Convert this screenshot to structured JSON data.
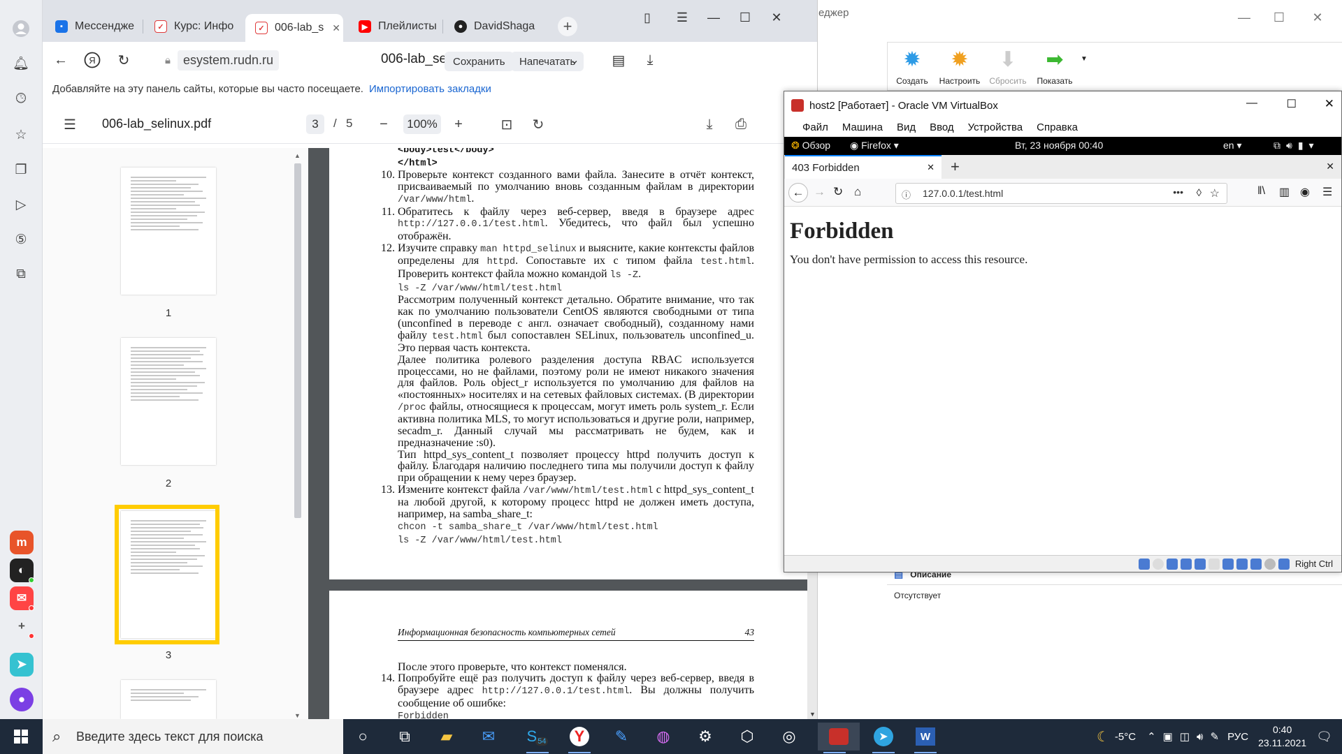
{
  "browser": {
    "tabs": [
      {
        "label": "Мессендже",
        "fav_color": "#1a73e8"
      },
      {
        "label": "Курс: Инфо",
        "fav_color": "#e03a3a"
      },
      {
        "label": "006-lab_s",
        "fav_color": "#e03a3a"
      },
      {
        "label": "Плейлисты",
        "fav_color": "#ff0000"
      },
      {
        "label": "DavidShaga",
        "fav_color": "#222222"
      }
    ],
    "url": "esystem.rudn.ru",
    "doc_title": "006-lab_selinux.pdf",
    "save_label": "Сохранить",
    "print_label": "Напечатать",
    "bookmarks_hint": "Добавляйте на эту панель сайты, которые вы часто посещаете.",
    "import_link": "Импортировать закладки"
  },
  "pdf": {
    "file_name": "006-lab_selinux.pdf",
    "current_page": "3",
    "page_sep": "/",
    "total_pages": "5",
    "zoom": "100%",
    "thumbnails": [
      "1",
      "2",
      "3"
    ],
    "page3": {
      "top_code": "<body>test</body>",
      "top_code2": "</html>",
      "items": [
        {
          "num": "10.",
          "html": "Проверьте контекст созданного вами файла. Занесите в отчёт контекст, присваиваемый по умолчанию вновь созданным файлам в директории <span class='mono'>/var/www/html</span>."
        },
        {
          "num": "11.",
          "html": "Обратитесь к файлу через веб-сервер, введя в браузере адрес <span class='mono'>http://127.0.0.1/test.html</span>. Убедитесь, что файл был успешно отображён."
        },
        {
          "num": "12.",
          "html": "Изучите справку <span class='mono'>man httpd_selinux</span> и выясните, какие контексты файлов определены для <span class='mono'>httpd</span>. Сопоставьте их с типом файла <span class='mono'>test.html</span>. Проверить контекст файла можно командой <span class='mono'>ls -Z</span>.<br><span class='mono'>ls -Z /var/www/html/test.html</span><br>Рассмотрим полученный контекст детально. Обратите внимание, что так как по умолчанию пользователи CentOS являются свободными от типа (unconfined в переводе с англ. означает свободный), созданному нами файлу <span class='mono'>test.html</span> был сопоставлен SELinux, пользователь unconfined_u. Это первая часть контекста.<br>Далее политика ролевого разделения доступа RBAC используется процессами, но не файлами, поэтому роли не имеют никакого значения для файлов. Роль object_r используется по умолчанию для файлов на «постоянных» носителях и на сетевых файловых системах. (В директории <span class='mono'>/proc</span> файлы, относящиеся к процессам, могут иметь роль system_r. Если активна политика MLS, то могут использоваться и другие роли, например, secadm_r. Данный случай мы рассматривать не будем, как и предназначение :s0).<br>Тип httpd_sys_content_t позволяет процессу httpd получить доступ к файлу. Благодаря наличию последнего типа мы получили доступ к файлу при обращении к нему через браузер."
        },
        {
          "num": "13.",
          "html": "Измените контекст файла <span class='mono'>/var/www/html/test.html</span> с httpd_sys_content_t на любой другой, к которому процесс httpd не должен иметь доступа, например, на samba_share_t:<br><span class='mono'>chcon -t samba_share_t /var/www/html/test.html</span><br><span class='mono'>ls -Z /var/www/html/test.html</span>"
        }
      ]
    },
    "page4": {
      "header_left": "Информационная безопасность компьютерных сетей",
      "header_right": "43",
      "intro": "После этого проверьте, что контекст поменялся.",
      "item_num": "14.",
      "item_html": "Попробуйте ещё раз получить доступ к файлу через веб-сервер, введя в браузере адрес <span class='mono'>http://127.0.0.1/test.html</span>. Вы должны получить сообщение об ошибке:",
      "code": "Forbidden"
    }
  },
  "vbox_manager": {
    "title": "еджер",
    "tools": [
      "Создать",
      "Настроить",
      "Сбросить",
      "Показать"
    ],
    "desc_header": "Описание",
    "desc_value": "Отсутствует"
  },
  "vm_window": {
    "title": "host2 [Работает] - Oracle VM VirtualBox",
    "menu": [
      "Файл",
      "Машина",
      "Вид",
      "Ввод",
      "Устройства",
      "Справка"
    ],
    "gnome": {
      "overview": "Обзор",
      "app": "Firefox",
      "datetime": "Вт, 23 ноября  00:40",
      "lang": "en"
    },
    "ff_tab": "403 Forbidden",
    "ff_url": "127.0.0.1/test.html",
    "heading": "Forbidden",
    "message": "You don't have permission to access this resource.",
    "host_key": "Right Ctrl"
  },
  "taskbar": {
    "search_placeholder": "Введите здесь текст для поиска",
    "skype_badge": "54",
    "weather": "-5°C",
    "lang": "РУС",
    "time": "0:40",
    "date": "23.11.2021"
  }
}
